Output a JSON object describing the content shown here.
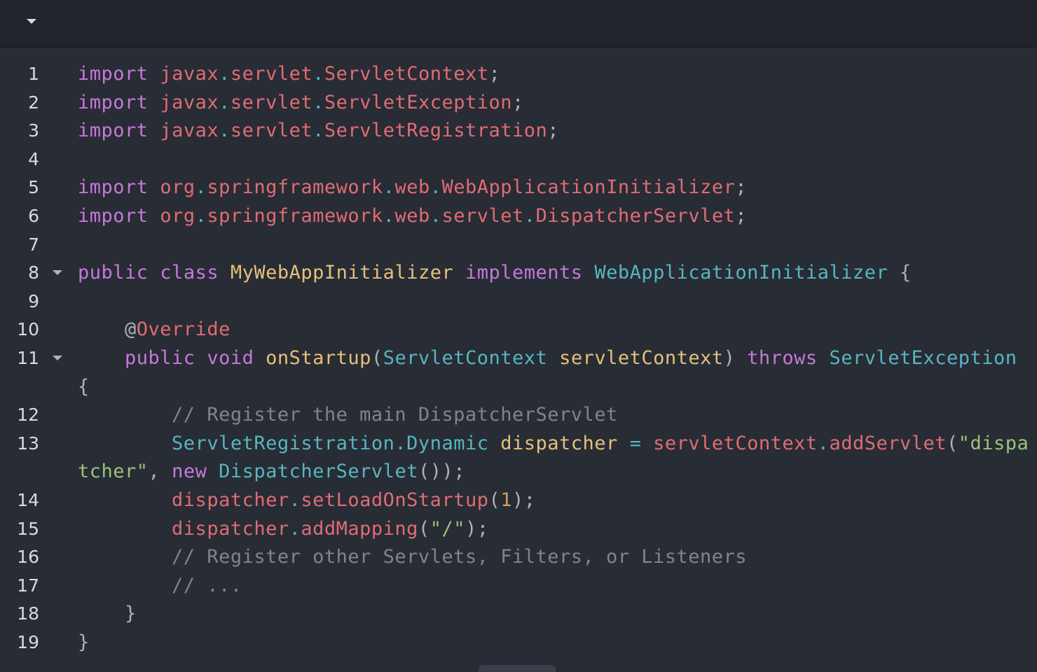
{
  "colors": {
    "background": "#282c34",
    "topbar": "#21252b",
    "default": "#abb2bf",
    "keyword": "#c678dd",
    "package": "#e06c75",
    "dot": "#56b6c2",
    "class": "#e5c07b",
    "type": "#56b6c2",
    "string": "#98c379",
    "number": "#d19a66",
    "comment": "#7f848e",
    "line_number": "#d7dae0"
  },
  "toolbar": {
    "collapse_icon": "chevron-down-icon"
  },
  "editor": {
    "lines": [
      {
        "number": "1",
        "fold": false,
        "tokens": [
          {
            "t": "import",
            "c": "keyword"
          },
          {
            "t": " "
          },
          {
            "t": "javax",
            "c": "package"
          },
          {
            "t": ".",
            "c": "dot"
          },
          {
            "t": "servlet",
            "c": "package"
          },
          {
            "t": ".",
            "c": "dot"
          },
          {
            "t": "ServletContext",
            "c": "package"
          },
          {
            "t": ";"
          }
        ]
      },
      {
        "number": "2",
        "fold": false,
        "tokens": [
          {
            "t": "import",
            "c": "keyword"
          },
          {
            "t": " "
          },
          {
            "t": "javax",
            "c": "package"
          },
          {
            "t": ".",
            "c": "dot"
          },
          {
            "t": "servlet",
            "c": "package"
          },
          {
            "t": ".",
            "c": "dot"
          },
          {
            "t": "ServletException",
            "c": "package"
          },
          {
            "t": ";"
          }
        ]
      },
      {
        "number": "3",
        "fold": false,
        "tokens": [
          {
            "t": "import",
            "c": "keyword"
          },
          {
            "t": " "
          },
          {
            "t": "javax",
            "c": "package"
          },
          {
            "t": ".",
            "c": "dot"
          },
          {
            "t": "servlet",
            "c": "package"
          },
          {
            "t": ".",
            "c": "dot"
          },
          {
            "t": "ServletRegistration",
            "c": "package"
          },
          {
            "t": ";"
          }
        ]
      },
      {
        "number": "4",
        "fold": false,
        "tokens": []
      },
      {
        "number": "5",
        "fold": false,
        "tokens": [
          {
            "t": "import",
            "c": "keyword"
          },
          {
            "t": " "
          },
          {
            "t": "org",
            "c": "package"
          },
          {
            "t": ".",
            "c": "dot"
          },
          {
            "t": "springframework",
            "c": "package"
          },
          {
            "t": ".",
            "c": "dot"
          },
          {
            "t": "web",
            "c": "package"
          },
          {
            "t": ".",
            "c": "dot"
          },
          {
            "t": "WebApplicationInitializer",
            "c": "package"
          },
          {
            "t": ";"
          }
        ]
      },
      {
        "number": "6",
        "fold": false,
        "tokens": [
          {
            "t": "import",
            "c": "keyword"
          },
          {
            "t": " "
          },
          {
            "t": "org",
            "c": "package"
          },
          {
            "t": ".",
            "c": "dot"
          },
          {
            "t": "springframework",
            "c": "package"
          },
          {
            "t": ".",
            "c": "dot"
          },
          {
            "t": "web",
            "c": "package"
          },
          {
            "t": ".",
            "c": "dot"
          },
          {
            "t": "servlet",
            "c": "package"
          },
          {
            "t": ".",
            "c": "dot"
          },
          {
            "t": "DispatcherServlet",
            "c": "package"
          },
          {
            "t": ";"
          }
        ]
      },
      {
        "number": "7",
        "fold": false,
        "tokens": []
      },
      {
        "number": "8",
        "fold": true,
        "tokens": [
          {
            "t": "public",
            "c": "keyword"
          },
          {
            "t": " "
          },
          {
            "t": "class",
            "c": "keyword"
          },
          {
            "t": " "
          },
          {
            "t": "MyWebAppInitializer",
            "c": "class"
          },
          {
            "t": " "
          },
          {
            "t": "implements",
            "c": "keyword"
          },
          {
            "t": " "
          },
          {
            "t": "WebApplicationInitializer",
            "c": "type"
          },
          {
            "t": " {"
          }
        ]
      },
      {
        "number": "9",
        "fold": false,
        "tokens": []
      },
      {
        "number": "10",
        "fold": false,
        "tokens": [
          {
            "t": "    @"
          },
          {
            "t": "Override",
            "c": "package"
          }
        ]
      },
      {
        "number": "11",
        "fold": true,
        "tokens": [
          {
            "t": "    "
          },
          {
            "t": "public",
            "c": "keyword"
          },
          {
            "t": " "
          },
          {
            "t": "void",
            "c": "keyword"
          },
          {
            "t": " "
          },
          {
            "t": "onStartup",
            "c": "class"
          },
          {
            "t": "("
          },
          {
            "t": "ServletContext",
            "c": "type"
          },
          {
            "t": " "
          },
          {
            "t": "servletContext",
            "c": "class"
          },
          {
            "t": ") "
          },
          {
            "t": "throws",
            "c": "keyword"
          },
          {
            "t": " "
          },
          {
            "t": "ServletException",
            "c": "type"
          },
          {
            "t": " "
          }
        ]
      },
      {
        "number": "",
        "fold": false,
        "tokens": [
          {
            "t": "{"
          }
        ]
      },
      {
        "number": "12",
        "fold": false,
        "tokens": [
          {
            "t": "        "
          },
          {
            "t": "// Register the main DispatcherServlet",
            "c": "comment"
          }
        ]
      },
      {
        "number": "13",
        "fold": false,
        "tokens": [
          {
            "t": "        "
          },
          {
            "t": "ServletRegistration",
            "c": "type"
          },
          {
            "t": ".",
            "c": "dot"
          },
          {
            "t": "Dynamic",
            "c": "type"
          },
          {
            "t": " "
          },
          {
            "t": "dispatcher",
            "c": "class"
          },
          {
            "t": " "
          },
          {
            "t": "=",
            "c": "dot"
          },
          {
            "t": " "
          },
          {
            "t": "servletContext",
            "c": "package"
          },
          {
            "t": ".",
            "c": "dot"
          },
          {
            "t": "addServlet",
            "c": "package"
          },
          {
            "t": "("
          },
          {
            "t": "\"dispa",
            "c": "string"
          }
        ]
      },
      {
        "number": "",
        "fold": false,
        "tokens": [
          {
            "t": "tcher\"",
            "c": "string"
          },
          {
            "t": ", "
          },
          {
            "t": "new",
            "c": "keyword"
          },
          {
            "t": " "
          },
          {
            "t": "DispatcherServlet",
            "c": "type"
          },
          {
            "t": "());"
          }
        ]
      },
      {
        "number": "14",
        "fold": false,
        "tokens": [
          {
            "t": "        "
          },
          {
            "t": "dispatcher",
            "c": "package"
          },
          {
            "t": ".",
            "c": "dot"
          },
          {
            "t": "setLoadOnStartup",
            "c": "package"
          },
          {
            "t": "("
          },
          {
            "t": "1",
            "c": "number"
          },
          {
            "t": ");"
          }
        ]
      },
      {
        "number": "15",
        "fold": false,
        "tokens": [
          {
            "t": "        "
          },
          {
            "t": "dispatcher",
            "c": "package"
          },
          {
            "t": ".",
            "c": "dot"
          },
          {
            "t": "addMapping",
            "c": "package"
          },
          {
            "t": "("
          },
          {
            "t": "\"/\"",
            "c": "string"
          },
          {
            "t": ");"
          }
        ]
      },
      {
        "number": "16",
        "fold": false,
        "tokens": [
          {
            "t": "        "
          },
          {
            "t": "// Register other Servlets, Filters, or Listeners",
            "c": "comment"
          }
        ]
      },
      {
        "number": "17",
        "fold": false,
        "tokens": [
          {
            "t": "        "
          },
          {
            "t": "// ...",
            "c": "comment"
          }
        ]
      },
      {
        "number": "18",
        "fold": false,
        "tokens": [
          {
            "t": "    }"
          }
        ]
      },
      {
        "number": "19",
        "fold": false,
        "tokens": [
          {
            "t": "}"
          }
        ]
      }
    ]
  }
}
